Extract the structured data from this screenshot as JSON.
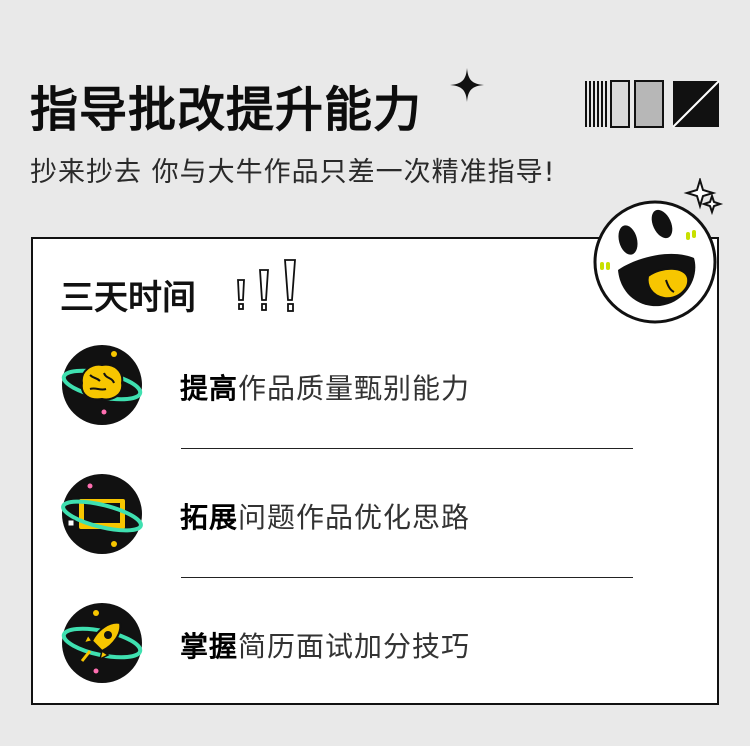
{
  "header": {
    "title": "指导批改提升能力",
    "subtitle": "抄来抄去 你与大牛作品只差一次精准指导!"
  },
  "card": {
    "title": "三天时间",
    "items": [
      {
        "bold": "提高",
        "text": "作品质量甄别能力",
        "icon": "brain-planet-icon"
      },
      {
        "bold": "拓展",
        "text": "问题作品优化思路",
        "icon": "screen-planet-icon"
      },
      {
        "bold": "掌握",
        "text": "简历面试加分技巧",
        "icon": "rocket-planet-icon"
      }
    ]
  },
  "colors": {
    "background": "#e9e9e9",
    "accent_yellow": "#f7c600",
    "accent_teal": "#3fe0b0",
    "accent_pink": "#ff6fb1",
    "dark": "#111111"
  }
}
